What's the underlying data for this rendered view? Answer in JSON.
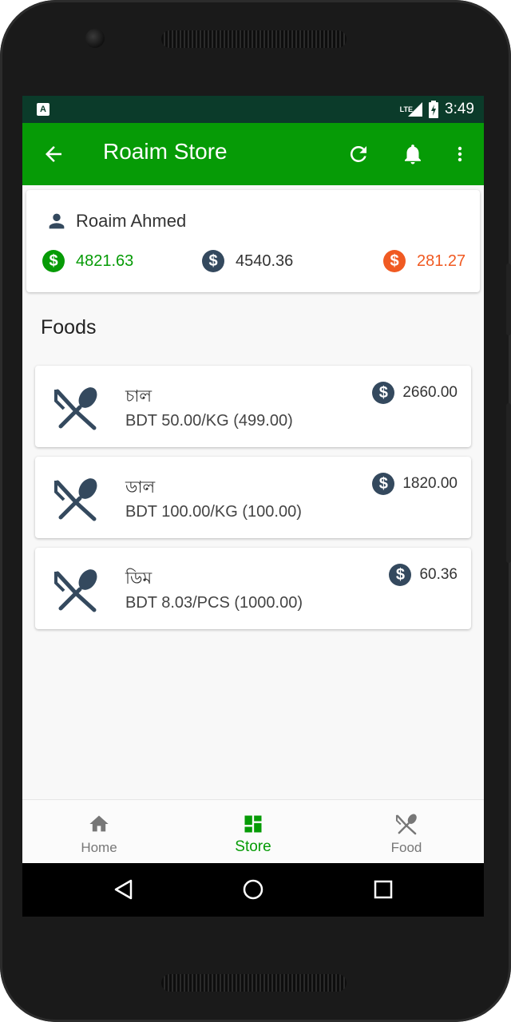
{
  "status_bar": {
    "time": "3:49",
    "network": "LTE",
    "notification_icon": "A"
  },
  "app_bar": {
    "title": "Roaim Store",
    "back_icon": "arrow-back-icon",
    "refresh_icon": "refresh-icon",
    "bell_icon": "bell-icon",
    "more_icon": "more-vert-icon"
  },
  "account": {
    "name": "Roaim Ahmed",
    "balances": [
      {
        "value": "4821.63",
        "color": "#069b06"
      },
      {
        "value": "4540.36",
        "color": "#34495e"
      },
      {
        "value": "281.27",
        "color": "#f05a22"
      }
    ]
  },
  "section_title": "Foods",
  "foods": [
    {
      "name": "চাল",
      "price_line": "BDT 50.00/KG (499.00)",
      "total": "2660.00"
    },
    {
      "name": "ডাল",
      "price_line": "BDT 100.00/KG (100.00)",
      "total": "1820.00"
    },
    {
      "name": "ডিম",
      "price_line": "BDT 8.03/PCS (1000.00)",
      "total": "60.36"
    }
  ],
  "bottom_nav": [
    {
      "label": "Home",
      "icon": "home-icon",
      "active": false
    },
    {
      "label": "Store",
      "icon": "dashboard-icon",
      "active": true
    },
    {
      "label": "Food",
      "icon": "restaurant-icon",
      "active": false
    }
  ],
  "colors": {
    "primary": "#069b06",
    "status_bar": "#0b3b2a",
    "dark_icon": "#34495e",
    "orange": "#f05a22"
  }
}
